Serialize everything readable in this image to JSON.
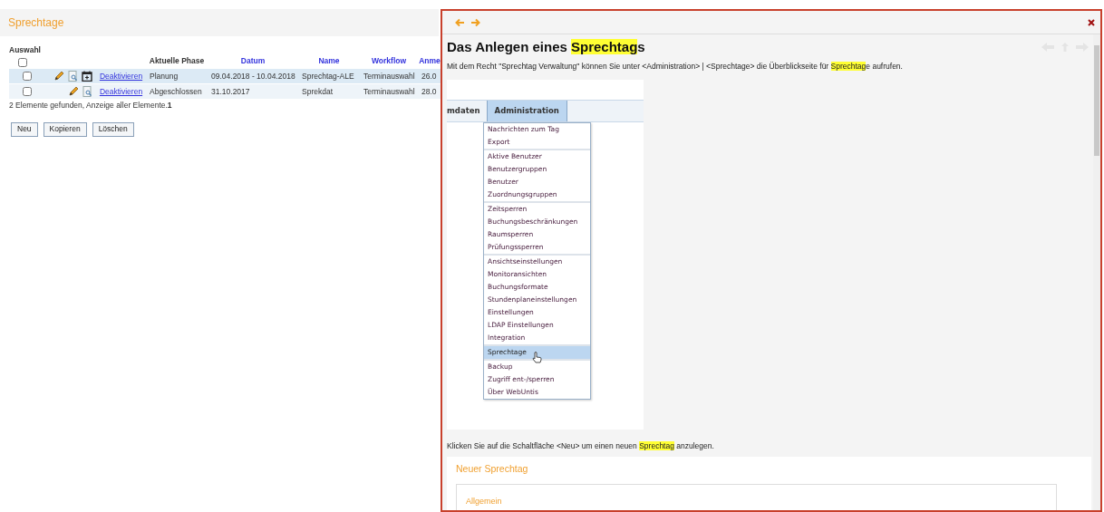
{
  "list_panel": {
    "title": "Sprechtage",
    "table": {
      "columns": [
        {
          "label": "Auswahl",
          "kind": "select",
          "checked": false
        },
        {
          "kind": "actions"
        },
        {
          "kind": "link"
        },
        {
          "label": "Aktuelle Phase",
          "kind": "plain"
        },
        {
          "label": "Datum",
          "kind": "sort"
        },
        {
          "label": "Name",
          "kind": "sort"
        },
        {
          "label": "Workflow",
          "kind": "sort"
        },
        {
          "label": "Anme",
          "kind": "sort"
        }
      ],
      "rows": [
        {
          "cells": [
            {
              "kind": "checkbox",
              "checked": false
            },
            {
              "kind": "actions",
              "actions": [
                {
                  "kind": "edit"
                },
                {
                  "kind": "preview"
                },
                {
                  "kind": "calendar"
                }
              ]
            },
            {
              "kind": "link",
              "text": "Deaktivieren"
            },
            {
              "kind": "text",
              "text": "Planung"
            },
            {
              "kind": "text",
              "text": "09.04.2018 - 10.04.2018"
            },
            {
              "kind": "text",
              "text": "Sprechtag-ALE"
            },
            {
              "kind": "text",
              "text": "Terminauswahl"
            },
            {
              "kind": "text",
              "text": "26.0"
            }
          ]
        },
        {
          "cells": [
            {
              "kind": "checkbox",
              "checked": false
            },
            {
              "kind": "actions",
              "actions": [
                {
                  "kind": "edit"
                },
                {
                  "kind": "preview"
                }
              ]
            },
            {
              "kind": "link",
              "text": "Deaktivieren"
            },
            {
              "kind": "text",
              "text": "Abgeschlossen"
            },
            {
              "kind": "text",
              "text": "31.10.2017"
            },
            {
              "kind": "text",
              "text": "Sprekdat"
            },
            {
              "kind": "text",
              "text": "Terminauswahl"
            },
            {
              "kind": "text",
              "text": "28.0"
            }
          ]
        }
      ]
    },
    "summary": "2 Elemente gefunden, Anzeige aller Elemente.**1**",
    "buttons": [
      "Neu",
      "Kopieren",
      "Löschen"
    ]
  },
  "help_panel": {
    "title": [
      {
        "text": "Das Anlegen eines ",
        "highlight": false
      },
      {
        "text": "Sprechtag",
        "highlight": true
      },
      {
        "text": "s",
        "highlight": false
      }
    ],
    "intro": [
      {
        "text": "Mit dem Recht \"Sprechtag Verwaltung\" können Sie unter <Administration> | <Sprechtage> die Überblickseite für ",
        "highlight": false
      },
      {
        "text": "Sprechtag",
        "highlight": true
      },
      {
        "text": "e aufrufen.",
        "highlight": false
      }
    ],
    "screenshot": {
      "menu_tabs": [
        {
          "label": "mdaten",
          "selected": false
        },
        {
          "label": "Administration",
          "selected": true
        }
      ],
      "dropdown": [
        [
          {
            "label": "Nachrichten zum Tag",
            "selected": false
          },
          {
            "label": "Export",
            "selected": false
          }
        ],
        [
          {
            "label": "Aktive Benutzer",
            "selected": false
          },
          {
            "label": "Benutzergruppen",
            "selected": false
          },
          {
            "label": "Benutzer",
            "selected": false
          },
          {
            "label": "Zuordnungsgruppen",
            "selected": false
          }
        ],
        [
          {
            "label": "Zeitsperren",
            "selected": false
          },
          {
            "label": "Buchungsbeschränkungen",
            "selected": false
          },
          {
            "label": "Raumsperren",
            "selected": false
          },
          {
            "label": "Prüfungssperren",
            "selected": false
          }
        ],
        [
          {
            "label": "Ansichtseinstellungen",
            "selected": false
          },
          {
            "label": "Monitoransichten",
            "selected": false
          },
          {
            "label": "Buchungsformate",
            "selected": false
          },
          {
            "label": "Stundenplaneinstellungen",
            "selected": false
          },
          {
            "label": "Einstellungen",
            "selected": false
          },
          {
            "label": "LDAP Einstellungen",
            "selected": false
          },
          {
            "label": "Integration",
            "selected": false
          }
        ],
        [
          {
            "label": "Sprechtage",
            "selected": true
          }
        ],
        [
          {
            "label": "Backup",
            "selected": false
          },
          {
            "label": "Zugriff ent-/sperren",
            "selected": false
          },
          {
            "label": "Über WebUntis",
            "selected": false
          }
        ]
      ]
    },
    "step": [
      {
        "text": "Klicken Sie auf die Schaltfläche <Neu> um einen neuen ",
        "highlight": false
      },
      {
        "text": "Sprechtag",
        "highlight": true
      },
      {
        "text": " anzulegen.",
        "highlight": false
      }
    ],
    "form_card": {
      "title": "Neuer Sprechtag",
      "section": "Allgemein"
    }
  }
}
